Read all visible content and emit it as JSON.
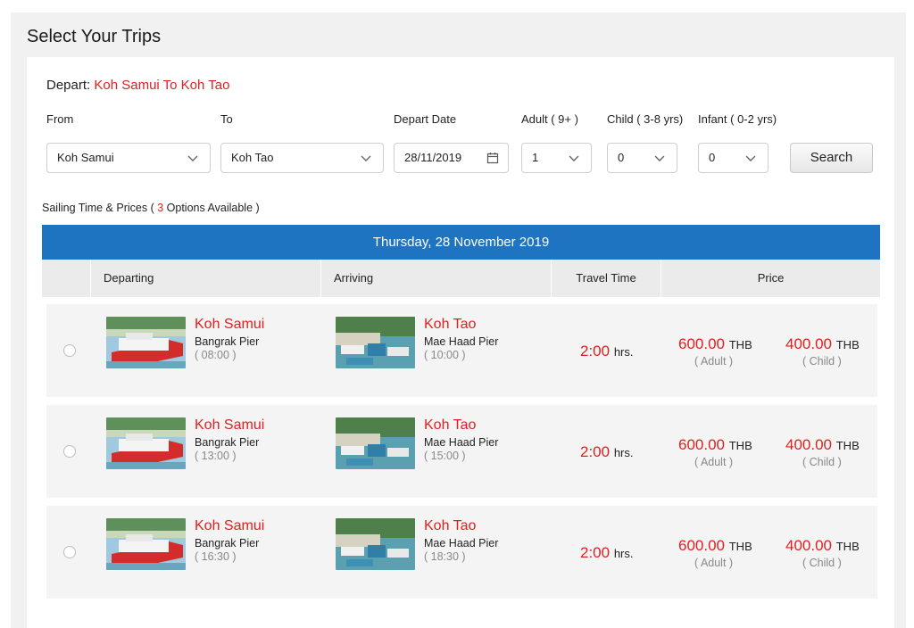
{
  "page": {
    "title": "Select Your Trips"
  },
  "depart": {
    "label": "Depart:",
    "route": "Koh Samui To Koh Tao"
  },
  "form": {
    "from_label": "From",
    "from_value": "Koh Samui",
    "to_label": "To",
    "to_value": "Koh Tao",
    "date_label": "Depart Date",
    "date_value": "28/11/2019",
    "adult_label": "Adult ( 9+ )",
    "adult_value": "1",
    "child_label": "Child ( 3-8 yrs)",
    "child_value": "0",
    "infant_label": "Infant ( 0-2 yrs)",
    "infant_value": "0",
    "search_label": "Search"
  },
  "sailing": {
    "prefix": "Sailing Time & Prices (",
    "count": "3",
    "suffix": "Options Available )"
  },
  "date_bar": "Thursday, 28 November 2019",
  "headers": {
    "departing": "Departing",
    "arriving": "Arriving",
    "travel_time": "Travel Time",
    "price": "Price"
  },
  "trips": [
    {
      "dep_place": "Koh Samui",
      "dep_pier": "Bangrak Pier",
      "dep_time": "( 08:00 )",
      "arr_place": "Koh Tao",
      "arr_pier": "Mae Haad Pier",
      "arr_time": "( 10:00 )",
      "travel": "2:00",
      "travel_unit": "hrs.",
      "adult_price": "600.00",
      "adult_cur": "THB",
      "adult_label": "( Adult )",
      "child_price": "400.00",
      "child_cur": "THB",
      "child_label": "( Child )"
    },
    {
      "dep_place": "Koh Samui",
      "dep_pier": "Bangrak Pier",
      "dep_time": "( 13:00 )",
      "arr_place": "Koh Tao",
      "arr_pier": "Mae Haad Pier",
      "arr_time": "( 15:00 )",
      "travel": "2:00",
      "travel_unit": "hrs.",
      "adult_price": "600.00",
      "adult_cur": "THB",
      "adult_label": "( Adult )",
      "child_price": "400.00",
      "child_cur": "THB",
      "child_label": "( Child )"
    },
    {
      "dep_place": "Koh Samui",
      "dep_pier": "Bangrak Pier",
      "dep_time": "( 16:30 )",
      "arr_place": "Koh Tao",
      "arr_pier": "Mae Haad Pier",
      "arr_time": "( 18:30 )",
      "travel": "2:00",
      "travel_unit": "hrs.",
      "adult_price": "600.00",
      "adult_cur": "THB",
      "adult_label": "( Adult )",
      "child_price": "400.00",
      "child_cur": "THB",
      "child_label": "( Child )"
    }
  ],
  "colors": {
    "accent_red": "#e0201f",
    "date_bar_blue": "#1f74c1"
  }
}
